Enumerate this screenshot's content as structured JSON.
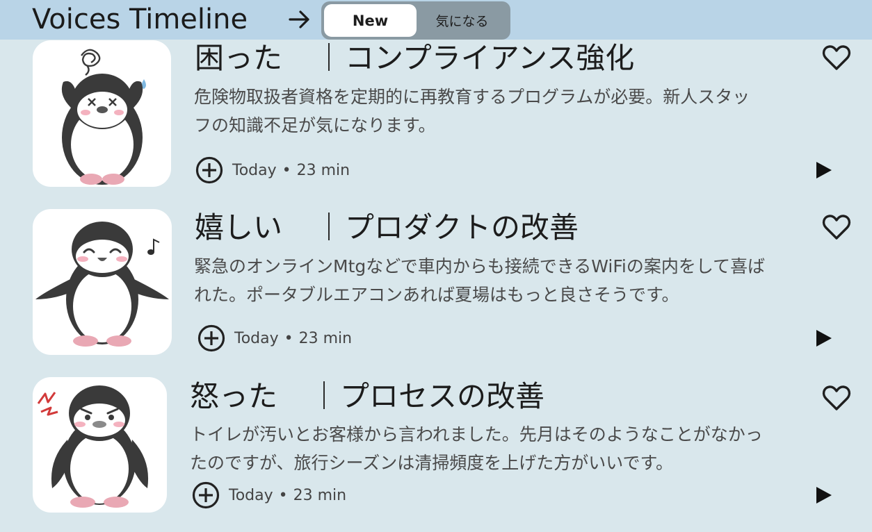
{
  "header": {
    "title": "Voices Timeline",
    "tabs": [
      {
        "label": "New",
        "active": true
      },
      {
        "label": "気になる",
        "active": false
      }
    ]
  },
  "icons": {
    "arrow": "arrow-right-icon",
    "add": "plus-circle-icon",
    "like": "heart-outline-icon",
    "play": "play-icon"
  },
  "colors": {
    "background": "#d9e7ec",
    "header": "#b9d4e7",
    "segment": "#8a9aa3"
  },
  "voices": [
    {
      "mood": "困った",
      "topic": "コンプライアンス強化",
      "body_line1": "危険物取扱者資格を定期的に再教育するプログラムが必要。新人スタッ",
      "body_line2": "フの知識不足が気になります。",
      "date": "Today",
      "duration": "23 min",
      "avatar": "troubled-penguin"
    },
    {
      "mood": "嬉しい",
      "topic": "プロダクトの改善",
      "body_line1": "緊急のオンラインMtgなどで車内からも接続できるWiFiの案内をして喜ば",
      "body_line2": "れた。ポータブルエアコンあれば夏場はもっと良さそうです。",
      "date": "Today",
      "duration": "23 min",
      "avatar": "happy-penguin"
    },
    {
      "mood": "怒った",
      "topic": "プロセスの改善",
      "body_line1": "トイレが汚いとお客様から言われました。先月はそのようなことがなかっ",
      "body_line2": "たのですが、旅行シーズンは清掃頻度を上げた方がいいです。",
      "date": "Today",
      "duration": "23 min",
      "avatar": "angry-penguin"
    }
  ]
}
